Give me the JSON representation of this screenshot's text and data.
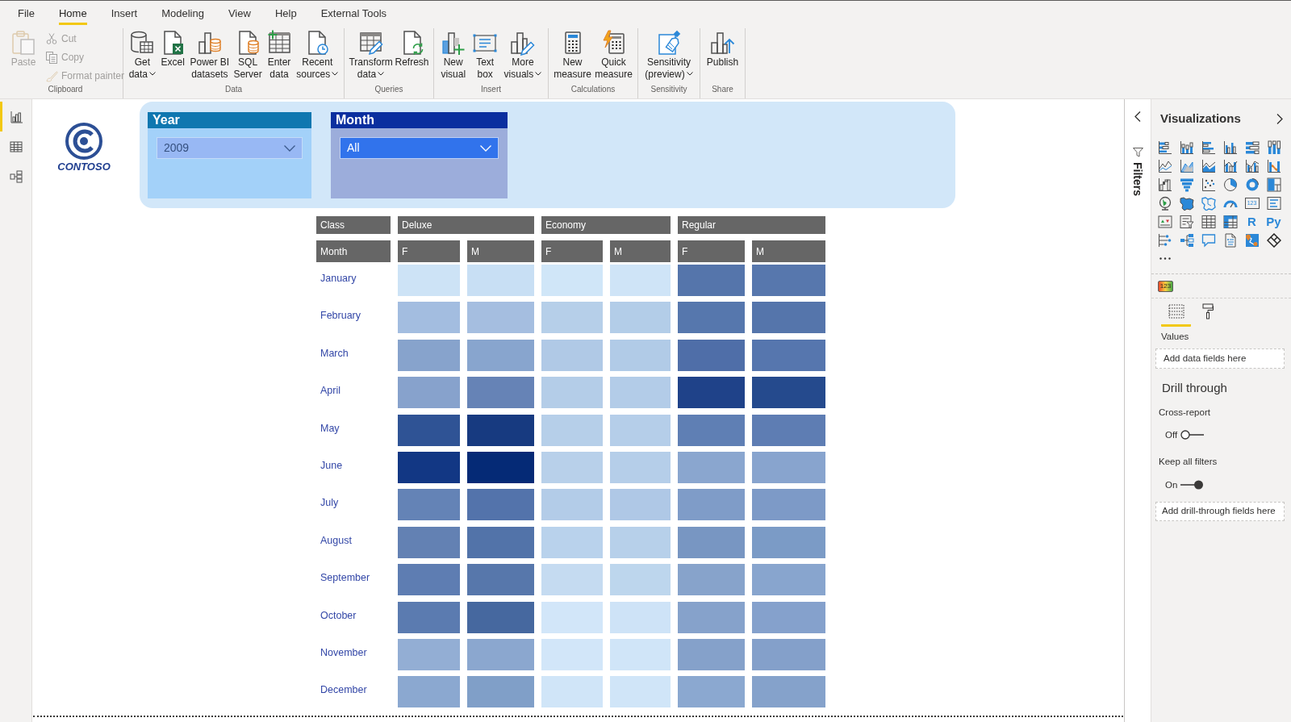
{
  "menu_tabs": [
    {
      "label": "File",
      "selected": false
    },
    {
      "label": "Home",
      "selected": true
    },
    {
      "label": "Insert",
      "selected": false
    },
    {
      "label": "Modeling",
      "selected": false
    },
    {
      "label": "View",
      "selected": false
    },
    {
      "label": "Help",
      "selected": false
    },
    {
      "label": "External Tools",
      "selected": false
    }
  ],
  "ribbon_groups": [
    {
      "label": "Clipboard",
      "buttons": [
        {
          "kind": "large",
          "lines": [
            "Paste"
          ],
          "disabled": true,
          "dropdown": false
        },
        {
          "kind": "small",
          "lines": [
            "Cut"
          ],
          "disabled": true,
          "dropdown": false
        },
        {
          "kind": "small",
          "lines": [
            "Copy"
          ],
          "disabled": true,
          "dropdown": false
        },
        {
          "kind": "small",
          "lines": [
            "Format painter"
          ],
          "disabled": true,
          "dropdown": false
        }
      ]
    },
    {
      "label": "Data",
      "buttons": [
        {
          "kind": "large",
          "lines": [
            "Get",
            "data"
          ],
          "disabled": false,
          "dropdown": true
        },
        {
          "kind": "large",
          "lines": [
            "Excel"
          ],
          "disabled": false,
          "dropdown": false
        },
        {
          "kind": "large",
          "lines": [
            "Power BI",
            "datasets"
          ],
          "disabled": false,
          "dropdown": false
        },
        {
          "kind": "large",
          "lines": [
            "SQL",
            "Server"
          ],
          "disabled": false,
          "dropdown": false
        },
        {
          "kind": "large",
          "lines": [
            "Enter",
            "data"
          ],
          "disabled": false,
          "dropdown": false
        },
        {
          "kind": "large",
          "lines": [
            "Recent",
            "sources"
          ],
          "disabled": false,
          "dropdown": true
        }
      ]
    },
    {
      "label": "Queries",
      "buttons": [
        {
          "kind": "large",
          "lines": [
            "Transform",
            "data"
          ],
          "disabled": false,
          "dropdown": true
        },
        {
          "kind": "large",
          "lines": [
            "Refresh"
          ],
          "disabled": false,
          "dropdown": false
        }
      ]
    },
    {
      "label": "Insert",
      "buttons": [
        {
          "kind": "large",
          "lines": [
            "New",
            "visual"
          ],
          "disabled": false,
          "dropdown": false
        },
        {
          "kind": "large",
          "lines": [
            "Text",
            "box"
          ],
          "disabled": false,
          "dropdown": false
        },
        {
          "kind": "large",
          "lines": [
            "More",
            "visuals"
          ],
          "disabled": false,
          "dropdown": true
        }
      ]
    },
    {
      "label": "Calculations",
      "buttons": [
        {
          "kind": "large",
          "lines": [
            "New",
            "measure"
          ],
          "disabled": false,
          "dropdown": false
        },
        {
          "kind": "large",
          "lines": [
            "Quick",
            "measure"
          ],
          "disabled": false,
          "dropdown": false
        }
      ]
    },
    {
      "label": "Sensitivity",
      "buttons": [
        {
          "kind": "large",
          "lines": [
            "Sensitivity",
            "(preview)"
          ],
          "disabled": false,
          "dropdown": true
        }
      ]
    },
    {
      "label": "Share",
      "buttons": [
        {
          "kind": "large",
          "lines": [
            "Publish"
          ],
          "disabled": false,
          "dropdown": false
        }
      ]
    }
  ],
  "view_nav": [
    {
      "selected": true
    },
    {
      "selected": false
    },
    {
      "selected": false
    }
  ],
  "logo": {
    "text": "CONTOSO"
  },
  "slicers": [
    {
      "title": "Year",
      "value": "2009",
      "color": "#0f77b0"
    },
    {
      "title": "Month",
      "value": "All",
      "color": "#0b2f9f"
    }
  ],
  "matrix": {
    "corner_labels": [
      "Class",
      "Month"
    ],
    "groups": [
      {
        "label": "Deluxe",
        "columns": [
          "F",
          "M"
        ]
      },
      {
        "label": "Economy",
        "columns": [
          "F",
          "M"
        ]
      },
      {
        "label": "Regular",
        "columns": [
          "F",
          "M"
        ]
      }
    ],
    "rows": [
      {
        "label": "January",
        "cells": [
          {
            "color": "#cde3f6"
          },
          {
            "color": "#c8dff4"
          },
          {
            "color": "#d0e6f8"
          },
          {
            "color": "#cfe4f7"
          },
          {
            "color": "#5575ab"
          },
          {
            "color": "#5777ad"
          }
        ]
      },
      {
        "label": "February",
        "cells": [
          {
            "color": "#a3bde0"
          },
          {
            "color": "#a5bee0"
          },
          {
            "color": "#b6cfe9"
          },
          {
            "color": "#b3cde8"
          },
          {
            "color": "#5677ad"
          },
          {
            "color": "#5575ab"
          }
        ]
      },
      {
        "label": "March",
        "cells": [
          {
            "color": "#87a3cc"
          },
          {
            "color": "#88a5ce"
          },
          {
            "color": "#b0c9e6"
          },
          {
            "color": "#b1cbe7"
          },
          {
            "color": "#4f6ea8"
          },
          {
            "color": "#5676ae"
          }
        ]
      },
      {
        "label": "April",
        "cells": [
          {
            "color": "#87a2cc"
          },
          {
            "color": "#6683b6"
          },
          {
            "color": "#b4cde8"
          },
          {
            "color": "#b3cce8"
          },
          {
            "color": "#1f4289"
          },
          {
            "color": "#254a8d"
          }
        ]
      },
      {
        "label": "May",
        "cells": [
          {
            "color": "#2f5395"
          },
          {
            "color": "#173a80"
          },
          {
            "color": "#b6cfe9"
          },
          {
            "color": "#b5cee9"
          },
          {
            "color": "#5f7fb4"
          },
          {
            "color": "#5e7db3"
          }
        ]
      },
      {
        "label": "June",
        "cells": [
          {
            "color": "#123784"
          },
          {
            "color": "#052a76"
          },
          {
            "color": "#b8d0ea"
          },
          {
            "color": "#b5cee9"
          },
          {
            "color": "#8aa6cf"
          },
          {
            "color": "#88a4ce"
          }
        ]
      },
      {
        "label": "July",
        "cells": [
          {
            "color": "#6483b6"
          },
          {
            "color": "#5373ab"
          },
          {
            "color": "#b3cce8"
          },
          {
            "color": "#afc8e6"
          },
          {
            "color": "#7f9cc8"
          },
          {
            "color": "#7d9ac7"
          }
        ]
      },
      {
        "label": "August",
        "cells": [
          {
            "color": "#6381b3"
          },
          {
            "color": "#5273a9"
          },
          {
            "color": "#b9d2ec"
          },
          {
            "color": "#b7d0ea"
          },
          {
            "color": "#7896c2"
          },
          {
            "color": "#7b9bc6"
          }
        ]
      },
      {
        "label": "September",
        "cells": [
          {
            "color": "#5e7db2"
          },
          {
            "color": "#5777ab"
          },
          {
            "color": "#c5dbf1"
          },
          {
            "color": "#bdd6ed"
          },
          {
            "color": "#87a3cb"
          },
          {
            "color": "#88a5ce"
          }
        ]
      },
      {
        "label": "October",
        "cells": [
          {
            "color": "#5b7bb0"
          },
          {
            "color": "#46689f"
          },
          {
            "color": "#d2e6f9"
          },
          {
            "color": "#cee3f7"
          },
          {
            "color": "#86a2cb"
          },
          {
            "color": "#85a1cc"
          }
        ]
      },
      {
        "label": "November",
        "cells": [
          {
            "color": "#93aed4"
          },
          {
            "color": "#8ba7cf"
          },
          {
            "color": "#d2e6f9"
          },
          {
            "color": "#d0e5f8"
          },
          {
            "color": "#85a1ca"
          },
          {
            "color": "#84a0ca"
          }
        ]
      },
      {
        "label": "December",
        "cells": [
          {
            "color": "#8ba8d0"
          },
          {
            "color": "#809fc8"
          },
          {
            "color": "#d0e5f8"
          },
          {
            "color": "#d0e5f8"
          },
          {
            "color": "#8ba8d0"
          },
          {
            "color": "#85a2cb"
          }
        ]
      }
    ]
  },
  "filters_pane": {
    "title": "Filters"
  },
  "visualizations": {
    "title": "Visualizations",
    "glyph_tiles": [
      "123",
      "R",
      "Py"
    ],
    "custom_visuals": [
      "123"
    ],
    "pane_tabs": [
      {
        "selected": true
      },
      {
        "selected": false
      }
    ],
    "values_label": "Values",
    "values_well": "Add data fields here",
    "drill_title": "Drill through",
    "toggles": [
      {
        "label": "Cross-report",
        "state_text": "Off",
        "on": false
      },
      {
        "label": "Keep all filters",
        "state_text": "On",
        "on": true
      }
    ],
    "drill_well": "Add drill-through fields here"
  }
}
